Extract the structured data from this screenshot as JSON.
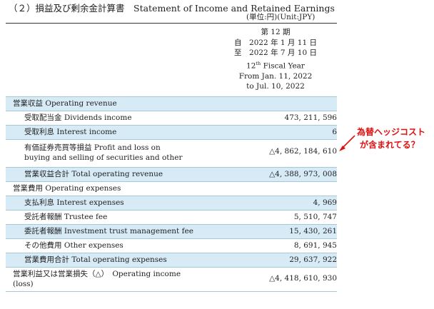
{
  "header": {
    "title": "（２）損益及び剰余金計算書　Statement of Income and Retained Earnings",
    "unit": "(単位:円)(Unit:JPY)"
  },
  "period": {
    "jp_term": "第 12 期",
    "jp_from": "自　2022 年 1 月 11 日",
    "jp_to": "至　2022 年 7 月 10 日",
    "en_term_num": "12",
    "en_term_sup": "th",
    "en_term_text": " Fiscal Year",
    "en_from": "From Jan. 11, 2022",
    "en_to": "to Jul. 10, 2022"
  },
  "rows": [
    {
      "label": "営業収益 Operating revenue",
      "value": ""
    },
    {
      "label": "受取配当金 Dividends income",
      "value": "473, 211, 596"
    },
    {
      "label": "受取利息 Interest income",
      "value": "6"
    },
    {
      "label_line1": "有価証券売買等損益 Profit and loss on",
      "label_line2": "buying and selling of securities and other",
      "value": "△4, 862, 184, 610"
    },
    {
      "label": "営業収益合計 Total operating revenue",
      "value": "△4, 388, 973, 008"
    },
    {
      "label": "営業費用 Operating expenses",
      "value": ""
    },
    {
      "label": "支払利息 Interest expenses",
      "value": "4, 969"
    },
    {
      "label": "受託者報酬 Trustee fee",
      "value": "5, 510, 747"
    },
    {
      "label": "委託者報酬 Investment trust management fee",
      "value": "15, 430, 261"
    },
    {
      "label": "その他費用 Other expenses",
      "value": "8, 691, 945"
    },
    {
      "label": "営業費用合計 Total operating expenses",
      "value": "29, 637, 922"
    },
    {
      "label_line1": "営業利益又は営業損失（△）　Operating income",
      "label_line2": "(loss)",
      "value": "△4, 418, 610, 930"
    }
  ],
  "annotation": {
    "line1": "為替ヘッジコスト",
    "line2": "が含まれてる？",
    "color": "#e01010"
  }
}
